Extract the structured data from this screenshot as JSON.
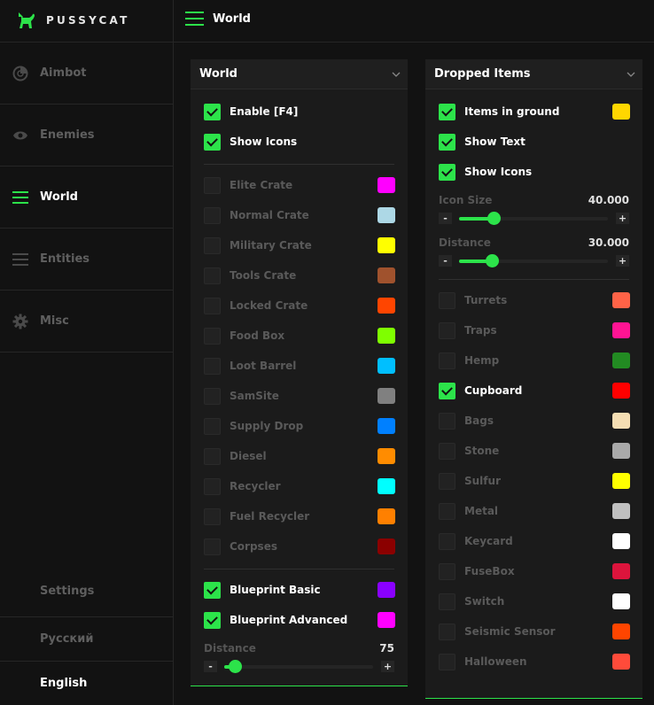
{
  "brand": {
    "name": "PUSSYCAT"
  },
  "header": {
    "title": "World"
  },
  "colors": {
    "accent": "#2ce34a"
  },
  "sidebar": {
    "items": [
      {
        "label": "Aimbot",
        "icon": "aimbot-icon",
        "active": false
      },
      {
        "label": "Enemies",
        "icon": "eye-icon",
        "active": false
      },
      {
        "label": "World",
        "icon": "menu-icon",
        "active": true
      },
      {
        "label": "Entities",
        "icon": "menu-icon",
        "active": false
      },
      {
        "label": "Misc",
        "icon": "gear-icon",
        "active": false
      }
    ],
    "bottom": [
      {
        "label": "Settings",
        "active": false
      },
      {
        "label": "Русский",
        "active": false
      },
      {
        "label": "English",
        "active": true
      }
    ]
  },
  "world_panel": {
    "title": "World",
    "top_options": [
      {
        "label": "Enable [F4]",
        "checked": true
      },
      {
        "label": "Show Icons",
        "checked": true
      }
    ],
    "items": [
      {
        "label": "Elite Crate",
        "checked": false,
        "color": "#ff00ff"
      },
      {
        "label": "Normal Crate",
        "checked": false,
        "color": "#add8e6"
      },
      {
        "label": "Military Crate",
        "checked": false,
        "color": "#ffff00"
      },
      {
        "label": "Tools Crate",
        "checked": false,
        "color": "#a0522d"
      },
      {
        "label": "Locked Crate",
        "checked": false,
        "color": "#ff4500"
      },
      {
        "label": "Food Box",
        "checked": false,
        "color": "#7fff00"
      },
      {
        "label": "Loot Barrel",
        "checked": false,
        "color": "#00bfff"
      },
      {
        "label": "SamSite",
        "checked": false,
        "color": "#808080"
      },
      {
        "label": "Supply Drop",
        "checked": false,
        "color": "#0080ff"
      },
      {
        "label": "Diesel",
        "checked": false,
        "color": "#ff8c00"
      },
      {
        "label": "Recycler",
        "checked": false,
        "color": "#00ffff"
      },
      {
        "label": "Fuel Recycler",
        "checked": false,
        "color": "#ff8000"
      },
      {
        "label": "Corpses",
        "checked": false,
        "color": "#8b0000"
      }
    ],
    "blueprints": [
      {
        "label": "Blueprint Basic",
        "checked": true,
        "color": "#8a00ff"
      },
      {
        "label": "Blueprint Advanced",
        "checked": true,
        "color": "#ff00ff"
      }
    ],
    "distance": {
      "label": "Distance",
      "value": "75",
      "fraction": 0.07,
      "minus": "-",
      "plus": "+"
    }
  },
  "dropped_panel": {
    "title": "Dropped Items",
    "top_options": [
      {
        "label": "Items in ground",
        "checked": true,
        "color": "#ffd700"
      },
      {
        "label": "Show Text",
        "checked": true
      },
      {
        "label": "Show Icons",
        "checked": true
      }
    ],
    "icon_size": {
      "label": "Icon Size",
      "value": "40.000",
      "fraction": 0.23,
      "minus": "-",
      "plus": "+"
    },
    "distance": {
      "label": "Distance",
      "value": "30.000",
      "fraction": 0.22,
      "minus": "-",
      "plus": "+"
    },
    "items": [
      {
        "label": "Turrets",
        "checked": false,
        "color": "#ff6347"
      },
      {
        "label": "Traps",
        "checked": false,
        "color": "#ff1493"
      },
      {
        "label": "Hemp",
        "checked": false,
        "color": "#228b22"
      },
      {
        "label": "Cupboard",
        "checked": true,
        "color": "#ff0000"
      },
      {
        "label": "Bags",
        "checked": false,
        "color": "#f5deb3"
      },
      {
        "label": "Stone",
        "checked": false,
        "color": "#a9a9a9"
      },
      {
        "label": "Sulfur",
        "checked": false,
        "color": "#ffff00"
      },
      {
        "label": "Metal",
        "checked": false,
        "color": "#c0c0c0"
      },
      {
        "label": "Keycard",
        "checked": false,
        "color": "#ffffff"
      },
      {
        "label": "FuseBox",
        "checked": false,
        "color": "#dc143c"
      },
      {
        "label": "Switch",
        "checked": false,
        "color": "#ffffff"
      },
      {
        "label": "Seismic Sensor",
        "checked": false,
        "color": "#ff4500"
      },
      {
        "label": "Halloween",
        "checked": false,
        "color": "#ff4b3a"
      }
    ]
  }
}
